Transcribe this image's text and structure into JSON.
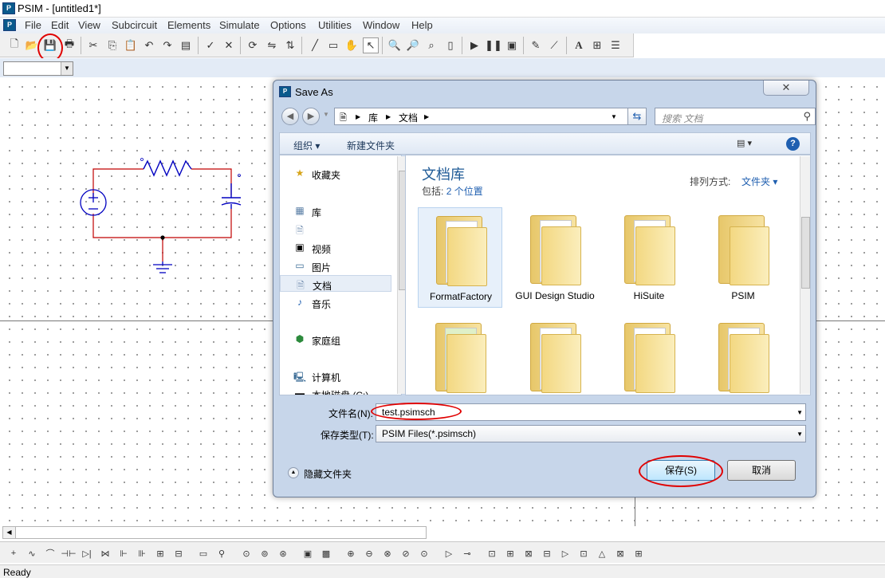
{
  "app": {
    "icon": "psim-app-icon",
    "title": "PSIM - [untitled1*]",
    "menus": [
      "File",
      "Edit",
      "View",
      "Subcircuit",
      "Elements",
      "Simulate",
      "Options",
      "Utilities",
      "Window",
      "Help"
    ],
    "status": "Ready"
  },
  "toolbar": {
    "buttons": [
      "new-icon",
      "open-icon",
      "save-icon",
      "print-icon",
      "cut-icon",
      "copy-icon",
      "paste-icon",
      "undo-icon",
      "redo-icon",
      "clipboard-icon",
      "check-icon",
      "cancel-icon",
      "rotate-icon",
      "flip-icon",
      "flip-vertical-icon",
      "wire-icon",
      "label-icon",
      "pan-icon",
      "select-icon",
      "zoom-in-icon",
      "zoom-out-icon",
      "zoom-fit-icon",
      "page-icon",
      "run-icon",
      "pause-icon",
      "scope-icon",
      "edit-icon",
      "probe-icon",
      "text-icon",
      "element-icon",
      "netlist-icon"
    ]
  },
  "dialog": {
    "title": "Save As",
    "close_symbol": "✕",
    "breadcrumb": [
      "库",
      "文档"
    ],
    "search_placeholder": "搜索 文档",
    "commands": {
      "organize": "组织 ▾",
      "new_folder": "新建文件夹"
    },
    "nav": [
      {
        "icon": "star-icon",
        "label": "收藏夹"
      },
      {
        "icon": "library-icon",
        "label": "库"
      },
      {
        "icon": "document-icon",
        "label": ""
      },
      {
        "icon": "video-icon",
        "label": "视频"
      },
      {
        "icon": "picture-icon",
        "label": "图片"
      },
      {
        "icon": "document-icon",
        "label": "文档"
      },
      {
        "icon": "music-icon",
        "label": "音乐"
      },
      {
        "icon": "homegroup-icon",
        "label": "家庭组"
      },
      {
        "icon": "computer-icon",
        "label": "计算机"
      },
      {
        "icon": "disk-icon",
        "label": "本地磁盘 (C:)"
      }
    ],
    "library_title": "文档库",
    "includes_prefix": "包括:",
    "includes_link": "2 个位置",
    "arrange_label": "排列方式:",
    "arrange_value": "文件夹 ▾",
    "folders": [
      {
        "label": "FormatFactory"
      },
      {
        "label": "GUI Design Studio"
      },
      {
        "label": "HiSuite"
      },
      {
        "label": "PSIM"
      },
      {
        "label": ""
      },
      {
        "label": ""
      },
      {
        "label": ""
      },
      {
        "label": ""
      }
    ],
    "filename_label": "文件名(N):",
    "filename_value": "test.psimsch",
    "filetype_label": "保存类型(T):",
    "filetype_value": "PSIM Files(*.psimsch)",
    "hide_folders": "隐藏文件夹",
    "save_button": "保存(S)",
    "cancel_button": "取消"
  },
  "combo_value": "",
  "colors": {
    "accent": "#1f5fb0",
    "annotation": "#e00000",
    "wire": "#c00000",
    "component": "#0000c0"
  }
}
